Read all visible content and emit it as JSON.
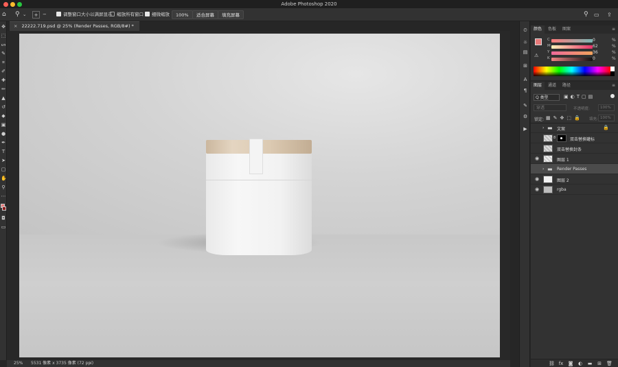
{
  "window": {
    "title": "Adobe Photoshop 2020",
    "traffic_lights": [
      "#ff5f57",
      "#febc2e",
      "#28c840"
    ]
  },
  "options_bar": {
    "tool_icon": "zoom-icon",
    "resize_windows_label": "调整窗口大小以满屏显示",
    "resize_windows_checked": true,
    "zoom_all_label": "缩放所有窗口",
    "zoom_all_checked": false,
    "scrubby_zoom_label": "细微缩放",
    "scrubby_zoom_checked": true,
    "zoom_value": "100%",
    "fit_screen_label": "适合屏幕",
    "fill_screen_label": "填充屏幕"
  },
  "document_tab": {
    "label": "22222.719.psd @ 25% (Render Passes, RGB/8#) *"
  },
  "status_bar": {
    "zoom": "25%",
    "info": "5531 像素 x 3735 像素 (72 ppi)"
  },
  "color_panel": {
    "tabs": [
      "颜色",
      "色板",
      "图案"
    ],
    "active_tab": "颜色",
    "foreground_color": "#e87a7a",
    "background_color": "#8b1a1a",
    "sliders": [
      {
        "label": "C",
        "value": "0"
      },
      {
        "label": "M",
        "value": "62"
      },
      {
        "label": "Y",
        "value": "36"
      },
      {
        "label": "K",
        "value": "0"
      }
    ],
    "unit": "%"
  },
  "layers_panel": {
    "tabs": [
      "图层",
      "通道",
      "路径"
    ],
    "active_tab": "图层",
    "filter_label": "Q 类型",
    "blend_mode": "穿透",
    "opacity_label": "不透明度:",
    "opacity_value": "100%",
    "lock_label": "锁定:",
    "fill_label": "填充:",
    "fill_value": "100%",
    "layers": [
      {
        "name": "文案",
        "type": "group",
        "visible": false,
        "locked": true
      },
      {
        "name": "双击替换罐标",
        "type": "smart",
        "visible": false,
        "locked": false
      },
      {
        "name": "双击替换封条",
        "type": "smart",
        "visible": false,
        "locked": false
      },
      {
        "name": "图层 1",
        "type": "layer",
        "visible": true,
        "locked": false
      },
      {
        "name": "Render Passes",
        "type": "group",
        "visible": false,
        "locked": false,
        "selected": true
      },
      {
        "name": "图层 2",
        "type": "layer",
        "visible": true,
        "locked": false
      },
      {
        "name": "rgba",
        "type": "layer",
        "visible": true,
        "locked": false
      }
    ]
  }
}
